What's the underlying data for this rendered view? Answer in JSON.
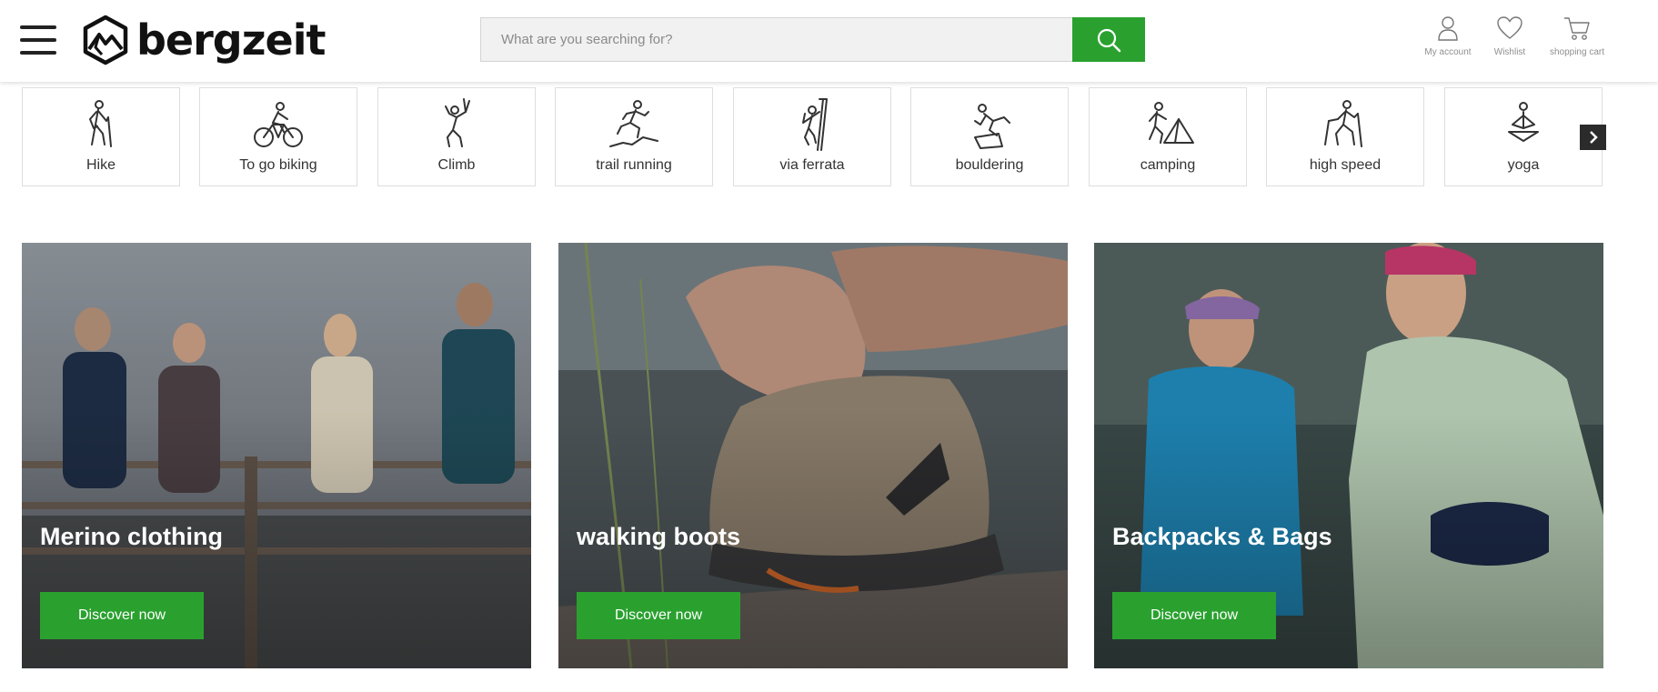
{
  "brand": {
    "name": "bergzeit",
    "accent": "#2aa12f"
  },
  "header": {
    "menu_icon": "hamburger-icon",
    "search": {
      "placeholder": "What are you searching for?",
      "value": "",
      "icon": "search-icon"
    },
    "actions": [
      {
        "label": "My account",
        "icon": "user-icon"
      },
      {
        "label": "Wishlist",
        "icon": "heart-icon"
      },
      {
        "label": "shopping cart",
        "icon": "cart-icon"
      }
    ]
  },
  "categories": [
    {
      "label": "Hike",
      "icon": "hiker-icon"
    },
    {
      "label": "To go biking",
      "icon": "cyclist-icon"
    },
    {
      "label": "Climb",
      "icon": "climber-icon"
    },
    {
      "label": "trail running",
      "icon": "trail-runner-icon"
    },
    {
      "label": "via ferrata",
      "icon": "via-ferrata-icon"
    },
    {
      "label": "bouldering",
      "icon": "boulderer-icon"
    },
    {
      "label": "camping",
      "icon": "camping-icon"
    },
    {
      "label": "high speed",
      "icon": "speed-hiker-icon"
    },
    {
      "label": "yoga",
      "icon": "yoga-icon"
    }
  ],
  "carousel_next_icon": "chevron-right-icon",
  "promos": [
    {
      "title": "Merino clothing",
      "button": "Discover now"
    },
    {
      "title": "walking boots",
      "button": "Discover now"
    },
    {
      "title": "Backpacks & Bags",
      "button": "Discover now"
    }
  ]
}
